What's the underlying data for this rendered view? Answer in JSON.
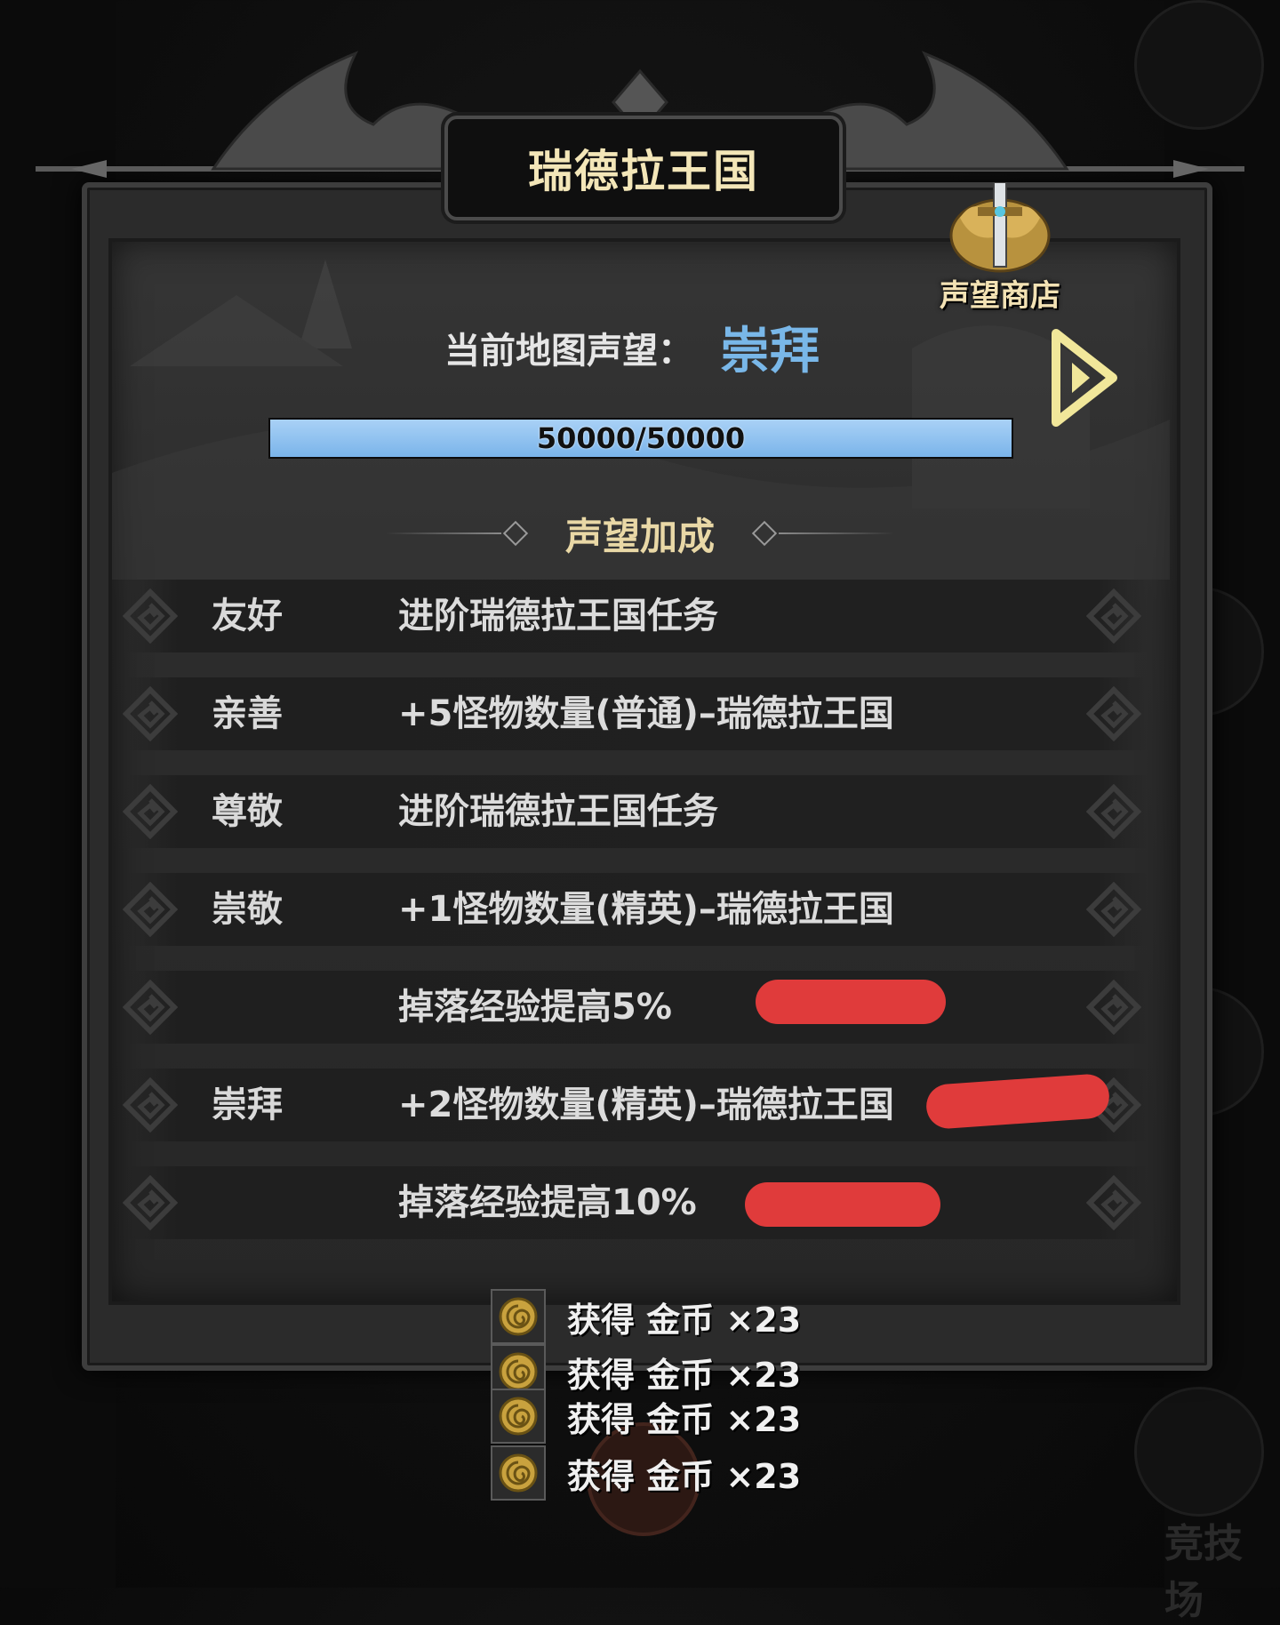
{
  "title": "瑞德拉王国",
  "shop": {
    "label": "声望商店"
  },
  "reputation": {
    "label": "当前地图声望：",
    "value": "崇拜"
  },
  "progress": {
    "text": "50000/50000",
    "current": 50000,
    "max": 50000
  },
  "section_title": "声望加成",
  "bonus_rows": [
    {
      "tier": "友好",
      "effect": "进阶瑞德拉王国任务"
    },
    {
      "tier": "亲善",
      "effect": "+5怪物数量(普通)–瑞德拉王国"
    },
    {
      "tier": "尊敬",
      "effect": "进阶瑞德拉王国任务"
    },
    {
      "tier": "崇敬",
      "effect": "+1怪物数量(精英)–瑞德拉王国"
    },
    {
      "tier": "",
      "effect": "掉落经验提高5%"
    },
    {
      "tier": "崇拜",
      "effect": "+2怪物数量(精英)–瑞德拉王国"
    },
    {
      "tier": "",
      "effect": "掉落经验提高10%"
    }
  ],
  "toasts": [
    {
      "text": "获得 金币 ×23"
    },
    {
      "text": "获得 金币 ×23"
    },
    {
      "text": "获得 金币 ×23"
    },
    {
      "text": "获得 金币 ×23"
    }
  ],
  "side_labels": [
    "竞技场"
  ],
  "colors": {
    "accent_blue": "#79b7e8",
    "gold": "#f3e2b4",
    "redaction": "#e03b3b"
  },
  "icons": [
    "shop-sword-icon",
    "next-arrow-icon",
    "spiral-ornament-icon",
    "gold-coin-icon"
  ]
}
